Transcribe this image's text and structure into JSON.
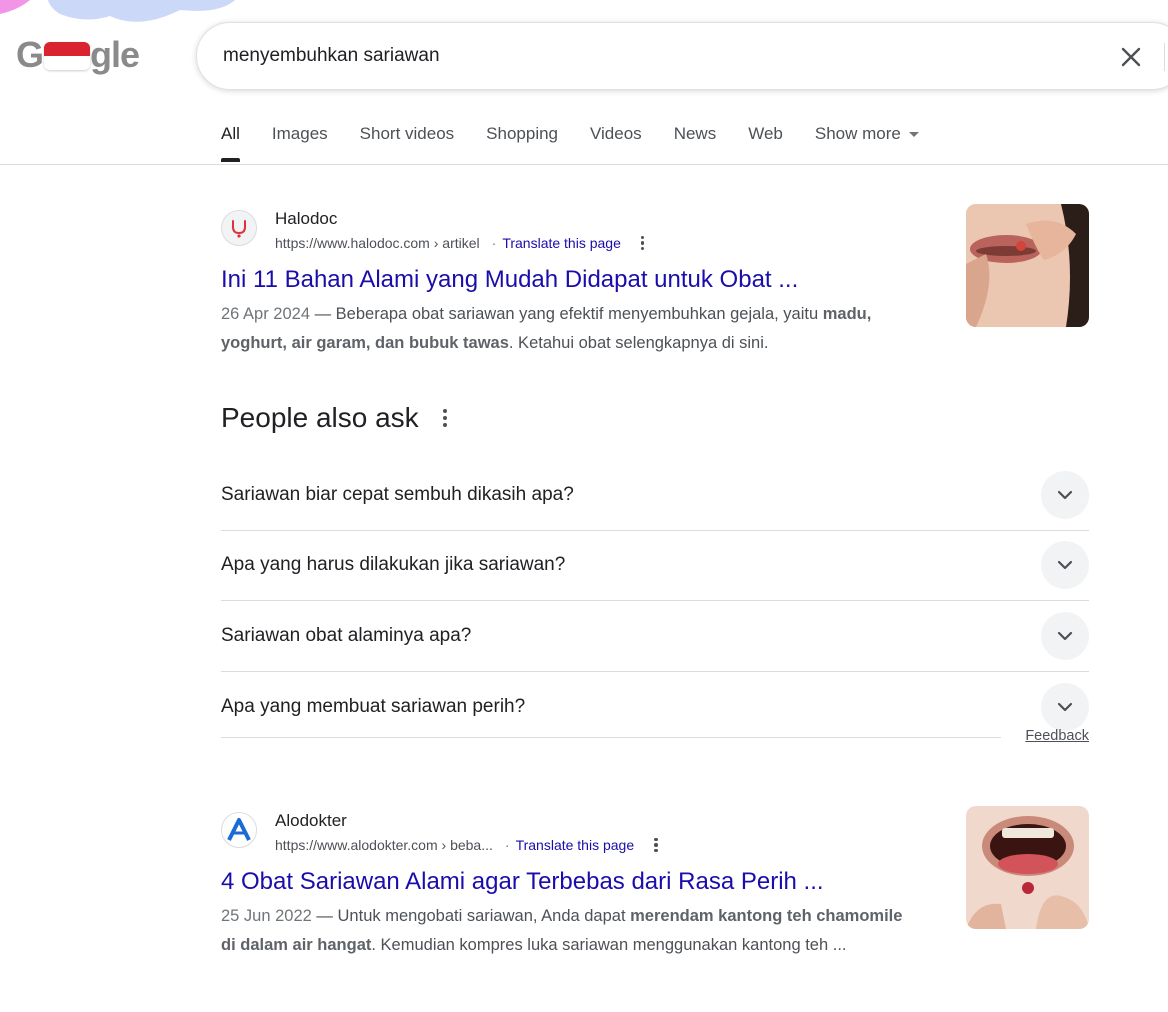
{
  "search": {
    "query": "menyembuhkan sariawan"
  },
  "logo": {
    "text_left": "G",
    "text_right": "gle"
  },
  "tabs": [
    {
      "label": "All",
      "active": true
    },
    {
      "label": "Images"
    },
    {
      "label": "Short videos"
    },
    {
      "label": "Shopping"
    },
    {
      "label": "Videos"
    },
    {
      "label": "News"
    },
    {
      "label": "Web"
    },
    {
      "label": "Show more"
    }
  ],
  "results": [
    {
      "site_name": "Halodoc",
      "url": "https://www.halodoc.com › artikel",
      "translate": "Translate this page",
      "title": "Ini 11 Bahan Alami yang Mudah Didapat untuk Obat ...",
      "date": "26 Apr 2024",
      "dash": " — ",
      "snippet_a": "Beberapa obat sariawan yang efektif menyembuhkan gejala, yaitu ",
      "snippet_bold": "madu, yoghurt, air garam, dan bubuk tawas",
      "snippet_b": ". Ketahui obat selengkapnya di sini."
    },
    {
      "site_name": "Alodokter",
      "url": "https://www.alodokter.com › beba...",
      "translate": "Translate this page",
      "title": "4 Obat Sariawan Alami agar Terbebas dari Rasa Perih ...",
      "date": "25 Jun 2022",
      "dash": " — ",
      "snippet_a": "Untuk mengobati sariawan, Anda dapat ",
      "snippet_bold": "merendam kantong teh chamomile di dalam air hangat",
      "snippet_b": ". Kemudian kompres luka sariawan menggunakan kantong teh ..."
    }
  ],
  "paa": {
    "title": "People also ask",
    "questions": [
      "Sariawan biar cepat sembuh dikasih apa?",
      "Apa yang harus dilakukan jika sariawan?",
      "Sariawan obat alaminya apa?",
      "Apa yang membuat sariawan perih?"
    ],
    "feedback": "Feedback"
  },
  "colors": {
    "link": "#1a0dab",
    "flag_red": "#d9232e",
    "favicon_halodoc": "#e0313b",
    "favicon_alodokter": "#1a6bd6"
  }
}
